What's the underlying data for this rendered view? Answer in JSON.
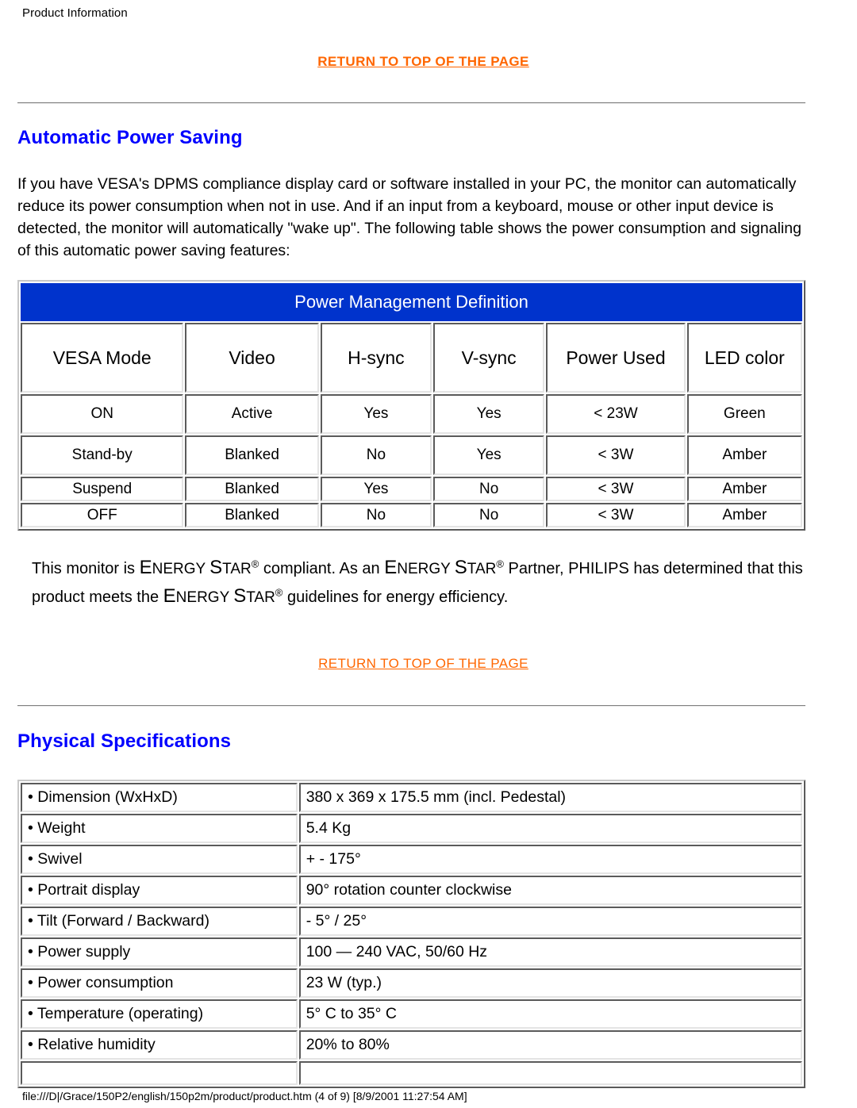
{
  "document": {
    "running_header": "Product Information",
    "footer": "file:///D|/Grace/150P2/english/150p2m/product/product.htm (4 of 9) [8/9/2001 11:27:54 AM]",
    "link_color": "#FF6600",
    "heading_color": "#0000FF",
    "banner_color": "#0033CC"
  },
  "links": {
    "return_to_top_1": "RETURN TO TOP OF THE PAGE",
    "return_to_top_2": "RETURN TO TOP OF THE PAGE"
  },
  "power_saving": {
    "title": "Automatic Power Saving",
    "paragraph": "If you have VESA's DPMS compliance display card or software installed in your PC, the monitor can automatically reduce its power consumption when not in use. And if an input from a keyboard, mouse or other input device is detected, the monitor will automatically \"wake up\". The following table shows the power consumption and signaling of this automatic power saving features:"
  },
  "power_table": {
    "banner": "Power Management Definition",
    "columns": [
      "VESA Mode",
      "Video",
      "H-sync",
      "V-sync",
      "Power Used",
      "LED color"
    ],
    "rows": [
      [
        "ON",
        "Active",
        "Yes",
        "Yes",
        "< 23W",
        "Green"
      ],
      [
        "Stand-by",
        "Blanked",
        "No",
        "Yes",
        "< 3W",
        "Amber"
      ],
      [
        "Suspend",
        "Blanked",
        "Yes",
        "No",
        "< 3W",
        "Amber"
      ],
      [
        "OFF",
        "Blanked",
        "No",
        "No",
        "< 3W",
        "Amber"
      ]
    ]
  },
  "energy_star": {
    "part1": "This monitor is ",
    "es1_big": "E",
    "es1_small": "NERGY ",
    "es1_big2": "S",
    "es1_small2": "TAR",
    "part2": " compliant. As an ",
    "part3": " Partner, PHILIPS has determined that this product meets the ",
    "part4": " guidelines for energy efficiency.",
    "full_text": "This monitor is ENERGY STAR® compliant. As an ENERGY STAR® Partner, PHILIPS has determined that this product meets the ENERGY STAR® guidelines for energy efficiency."
  },
  "physical_specs": {
    "title": "Physical Specifications",
    "rows": [
      {
        "label": "• Dimension (WxHxD)",
        "value": "380 x 369 x 175.5 mm (incl. Pedestal)"
      },
      {
        "label": "• Weight",
        "value": "5.4 Kg"
      },
      {
        "label": "• Swivel",
        "value": "+ - 175°"
      },
      {
        "label": "• Portrait display",
        "value": "90° rotation counter clockwise"
      },
      {
        "label": "• Tilt (Forward / Backward)",
        "value": "- 5° / 25°"
      },
      {
        "label": "• Power supply",
        "value": "100 — 240 VAC, 50/60 Hz"
      },
      {
        "label": "• Power consumption",
        "value": "23 W (typ.)"
      },
      {
        "label": "• Temperature (operating)",
        "value": "5° C to 35° C"
      },
      {
        "label": "• Relative humidity",
        "value": "20% to 80%"
      }
    ]
  }
}
